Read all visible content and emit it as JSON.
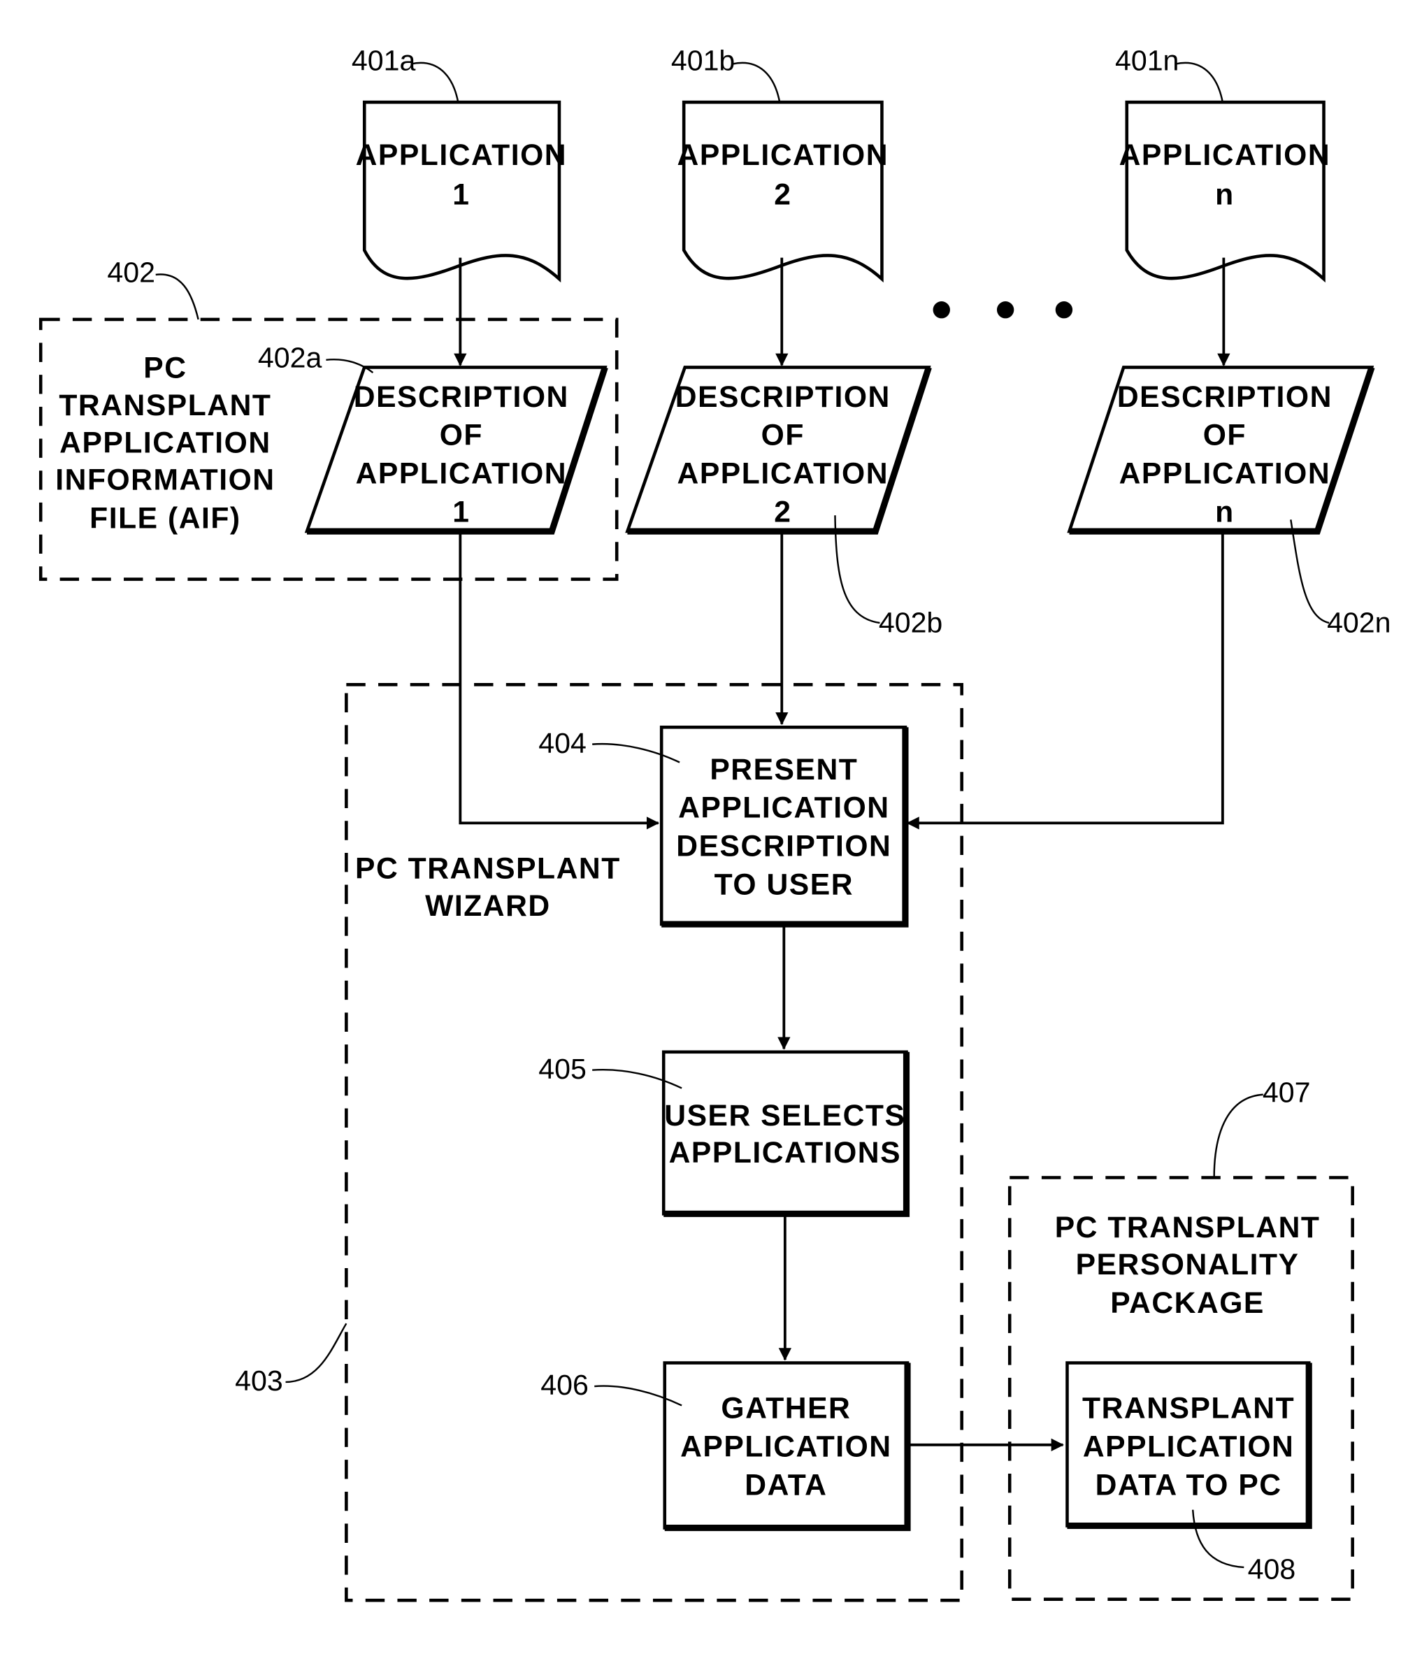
{
  "applications": [
    {
      "ref": "401a",
      "line1": "APPLICATION",
      "line2": "1"
    },
    {
      "ref": "401b",
      "line1": "APPLICATION",
      "line2": "2"
    },
    {
      "ref": "401n",
      "line1": "APPLICATION",
      "line2": "n"
    }
  ],
  "descriptions": [
    {
      "ref": "402a",
      "lines": [
        "DESCRIPTION",
        "OF",
        "APPLICATION",
        "1"
      ]
    },
    {
      "ref": "402b",
      "lines": [
        "DESCRIPTION",
        "OF",
        "APPLICATION",
        "2"
      ]
    },
    {
      "ref": "402n",
      "lines": [
        "DESCRIPTION",
        "OF",
        "APPLICATION",
        "n"
      ]
    }
  ],
  "aif_group": {
    "ref": "402",
    "lines": [
      "PC",
      "TRANSPLANT",
      "APPLICATION",
      "INFORMATION",
      "FILE (AIF)"
    ]
  },
  "wizard_group": {
    "ref": "403",
    "lines": [
      "PC TRANSPLANT",
      "WIZARD"
    ]
  },
  "steps": [
    {
      "ref": "404",
      "lines": [
        "PRESENT",
        "APPLICATION",
        "DESCRIPTION",
        "TO USER"
      ]
    },
    {
      "ref": "405",
      "lines": [
        "USER SELECTS",
        "APPLICATIONS"
      ]
    },
    {
      "ref": "406",
      "lines": [
        "GATHER",
        "APPLICATION",
        "DATA"
      ]
    }
  ],
  "package_group": {
    "ref": "407",
    "lines": [
      "PC TRANSPLANT",
      "PERSONALITY",
      "PACKAGE"
    ]
  },
  "transplant_step": {
    "ref": "408",
    "lines": [
      "TRANSPLANT",
      "APPLICATION",
      "DATA TO PC"
    ]
  },
  "ellipsis": "• • •"
}
